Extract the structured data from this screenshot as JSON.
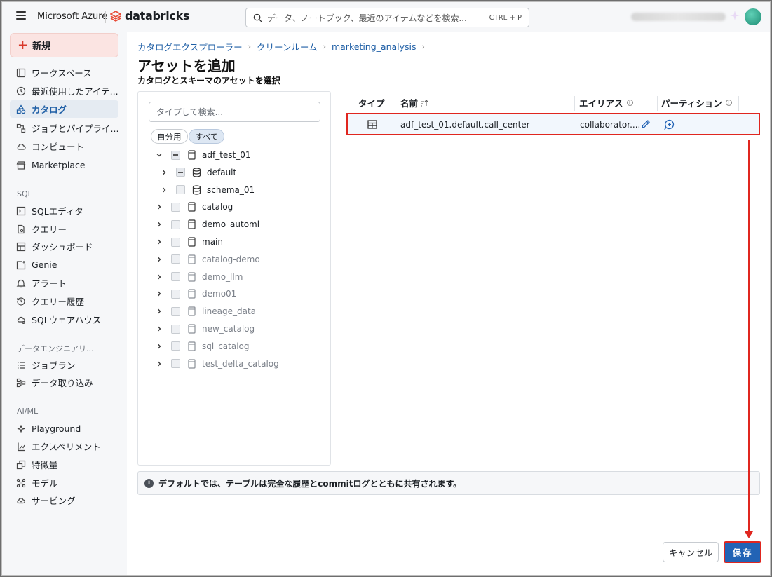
{
  "topbar": {
    "brand_ms": "Microsoft Azure",
    "brand_db": "databricks",
    "search_placeholder": "データ、ノートブック、最近のアイテムなどを検索...",
    "search_shortcut": "CTRL + P"
  },
  "sidebar": {
    "new_label": "新規",
    "items": [
      {
        "label": "ワークスペース",
        "icon": "workspace-icon"
      },
      {
        "label": "最近使用したアイテ...",
        "icon": "clock-icon"
      },
      {
        "label": "カタログ",
        "icon": "catalog-icon",
        "active": true
      },
      {
        "label": "ジョブとパイプライ...",
        "icon": "jobs-icon"
      },
      {
        "label": "コンピュート",
        "icon": "cloud-icon"
      },
      {
        "label": "Marketplace",
        "icon": "store-icon"
      }
    ],
    "sql_section": "SQL",
    "sql_items": [
      {
        "label": "SQLエディタ",
        "icon": "sql-editor-icon"
      },
      {
        "label": "クエリー",
        "icon": "query-icon"
      },
      {
        "label": "ダッシュボード",
        "icon": "dashboard-icon"
      },
      {
        "label": "Genie",
        "icon": "genie-icon"
      },
      {
        "label": "アラート",
        "icon": "bell-icon"
      },
      {
        "label": "クエリー履歴",
        "icon": "history-icon"
      },
      {
        "label": "SQLウェアハウス",
        "icon": "warehouse-icon"
      }
    ],
    "de_section": "データエンジニアリ...",
    "de_items": [
      {
        "label": "ジョブラン",
        "icon": "job-runs-icon"
      },
      {
        "label": "データ取り込み",
        "icon": "ingest-icon"
      }
    ],
    "ai_section": "AI/ML",
    "ai_items": [
      {
        "label": "Playground",
        "icon": "playground-icon"
      },
      {
        "label": "エクスペリメント",
        "icon": "experiment-icon"
      },
      {
        "label": "特徴量",
        "icon": "features-icon"
      },
      {
        "label": "モデル",
        "icon": "models-icon"
      },
      {
        "label": "サービング",
        "icon": "serving-icon"
      }
    ]
  },
  "main": {
    "breadcrumb": [
      "カタログエクスプローラー",
      "クリーンルーム",
      "marketing_analysis"
    ],
    "title": "アセットを追加",
    "subtitle": "カタログとスキーマのアセットを選択",
    "tree": {
      "search_placeholder": "タイプして検索...",
      "filter_mine": "自分用",
      "filter_all": "すべて",
      "nodes": [
        {
          "label": "adf_test_01",
          "level": 0,
          "expanded": true,
          "state": "partial",
          "icon": "catalog-icon",
          "dim": false
        },
        {
          "label": "default",
          "level": 1,
          "expanded": false,
          "state": "partial",
          "icon": "schema-icon",
          "dim": false
        },
        {
          "label": "schema_01",
          "level": 1,
          "expanded": false,
          "state": "none",
          "icon": "schema-icon",
          "dim": false
        },
        {
          "label": "catalog",
          "level": 0,
          "expanded": false,
          "state": "none",
          "icon": "catalog-icon",
          "dim": false
        },
        {
          "label": "demo_automl",
          "level": 0,
          "expanded": false,
          "state": "none",
          "icon": "catalog-icon",
          "dim": false
        },
        {
          "label": "main",
          "level": 0,
          "expanded": false,
          "state": "none",
          "icon": "catalog-icon",
          "dim": false
        },
        {
          "label": "catalog-demo",
          "level": 0,
          "expanded": false,
          "state": "none",
          "icon": "catalog-icon",
          "dim": true
        },
        {
          "label": "demo_llm",
          "level": 0,
          "expanded": false,
          "state": "none",
          "icon": "catalog-icon",
          "dim": true
        },
        {
          "label": "demo01",
          "level": 0,
          "expanded": false,
          "state": "none",
          "icon": "catalog-icon",
          "dim": true
        },
        {
          "label": "lineage_data",
          "level": 0,
          "expanded": false,
          "state": "none",
          "icon": "catalog-icon",
          "dim": true
        },
        {
          "label": "new_catalog",
          "level": 0,
          "expanded": false,
          "state": "none",
          "icon": "catalog-icon",
          "dim": true
        },
        {
          "label": "sql_catalog",
          "level": 0,
          "expanded": false,
          "state": "none",
          "icon": "catalog-icon",
          "dim": true
        },
        {
          "label": "test_delta_catalog",
          "level": 0,
          "expanded": false,
          "state": "none",
          "icon": "catalog-icon",
          "dim": true
        }
      ]
    },
    "table": {
      "col_type": "タイプ",
      "col_name": "名前",
      "col_alias": "エイリアス",
      "col_partition": "パーティション",
      "rows": [
        {
          "type_icon": "table-icon",
          "name": "adf_test_01.default.call_center",
          "alias": "collaborator...."
        }
      ]
    },
    "info_text": "デフォルトでは、テーブルは完全な履歴とcommitログとともに共有されます。",
    "cancel_label": "キャンセル",
    "save_label": "保存"
  },
  "colors": {
    "accent": "#2263b5",
    "highlight": "#e0261f",
    "link": "#1f5fa6"
  }
}
